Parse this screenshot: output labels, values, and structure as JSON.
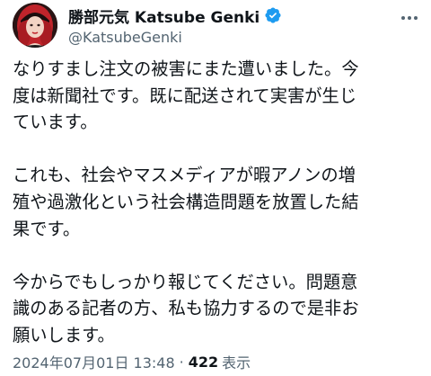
{
  "tweet": {
    "author": {
      "display_name": "勝部元気 Katsube Genki",
      "handle": "@KatsubeGenki",
      "verified": true
    },
    "paragraphs": [
      "なりすまし注文の被害にまた遭いました。今\n度は新聞社です。既に配送されて実害が生じ\nています。",
      "これも、社会やマスメディアが暇アノンの増\n殖や過激化という社会構造問題を放置した結\n果です。",
      "今からでもしっかり報じてください。問題意\n識のある記者の方、私も協力するので是非お\n願いします。"
    ],
    "timestamp": "2024年07月01日 13:48",
    "separator": "·",
    "views_count": "422",
    "views_label": "表示"
  },
  "colors": {
    "text_primary": "#0f1419",
    "text_secondary": "#536471",
    "verified_blue": "#1d9bf0"
  },
  "icons": {
    "verified": "verified-badge-icon",
    "more": "more-options-icon"
  }
}
